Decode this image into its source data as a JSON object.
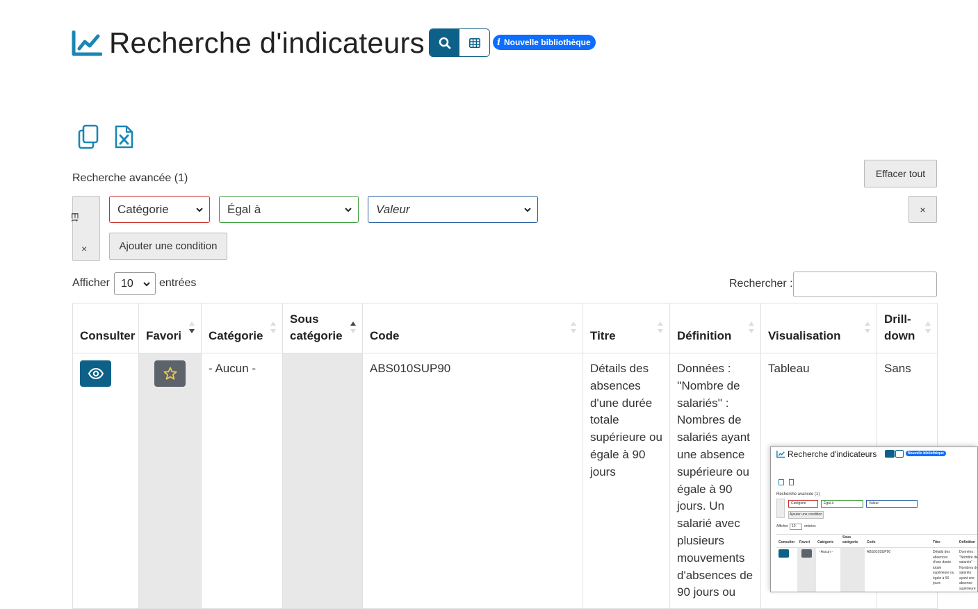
{
  "header": {
    "title": "Recherche d'indicateurs",
    "title_icon": "line-chart-icon",
    "view_buttons": [
      {
        "icon": "search-icon",
        "active": true
      },
      {
        "icon": "table-grid-icon",
        "active": false
      }
    ],
    "badge_icon_glyph": "i",
    "badge_label": "Nouvelle bibliothèque"
  },
  "toolbar": {
    "copy_icon": "copy-icon",
    "excel_icon": "excel-file-icon"
  },
  "advanced_search": {
    "label": "Recherche avancée (1)",
    "clear_all": "Effacer tout",
    "logic_label": "Et",
    "logic_remove": "×",
    "condition": {
      "field": "Catégorie",
      "operator": "Égal à",
      "value_placeholder": "Valeur"
    },
    "remove_condition": "×",
    "add_condition": "Ajouter une condition"
  },
  "length_menu": {
    "prefix": "Afficher",
    "value": "10",
    "suffix": "entrées"
  },
  "search": {
    "label": "Rechercher :",
    "value": ""
  },
  "table": {
    "columns": [
      {
        "label": "Consulter"
      },
      {
        "label": "Favori"
      },
      {
        "label": "Catégorie"
      },
      {
        "label": "Sous catégorie"
      },
      {
        "label": "Code"
      },
      {
        "label": "Titre"
      },
      {
        "label": "Définition"
      },
      {
        "label": "Visualisation"
      },
      {
        "label": "Drill-down"
      }
    ],
    "rows": [
      {
        "categorie": "- Aucun -",
        "sous_categorie": "",
        "code": "ABS010SUP90",
        "titre": "Détails des absences d'une durée totale supérieure ou égale à 90 jours",
        "definition": "Données : ''Nombre de salariés'' : Nombres de salariés ayant une absence supérieure ou égale à 90 jours. Un salarié avec plusieurs mouvements d'absences de 90 jours ou",
        "visualisation": "Tableau",
        "drilldown": "Sans"
      }
    ]
  },
  "colors": {
    "primary": "#0d6188",
    "badge": "#0d6efd",
    "secondary": "#5c636a",
    "field_border": "#c9302c",
    "operator_border": "#3c9a3c",
    "value_border": "#2a5f9e",
    "star": "#f3c94a"
  }
}
